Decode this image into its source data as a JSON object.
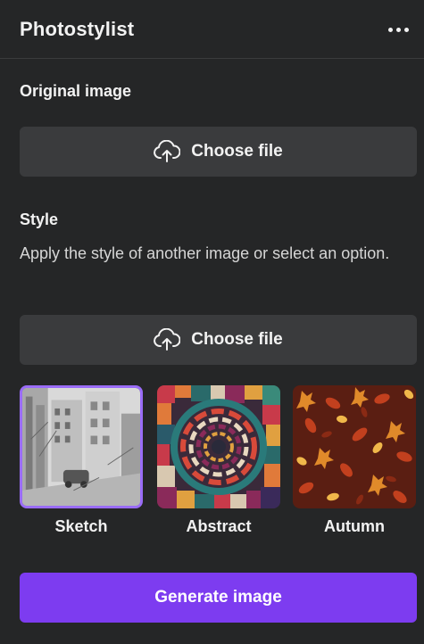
{
  "header": {
    "title": "Photostylist",
    "more_icon": "more-horizontal-icon"
  },
  "original_image": {
    "label": "Original image",
    "choose_label": "Choose file",
    "upload_icon": "cloud-upload-icon"
  },
  "style": {
    "label": "Style",
    "description": "Apply the style of another image or select an option.",
    "choose_label": "Choose file",
    "upload_icon": "cloud-upload-icon",
    "options": [
      {
        "label": "Sketch",
        "selected": true
      },
      {
        "label": "Abstract",
        "selected": false
      },
      {
        "label": "Autumn",
        "selected": false
      }
    ]
  },
  "generate": {
    "label": "Generate image"
  },
  "colors": {
    "background": "#252627",
    "button": "#3a3b3d",
    "accent": "#7d3cf0",
    "selected_border": "#9a6cf7"
  }
}
